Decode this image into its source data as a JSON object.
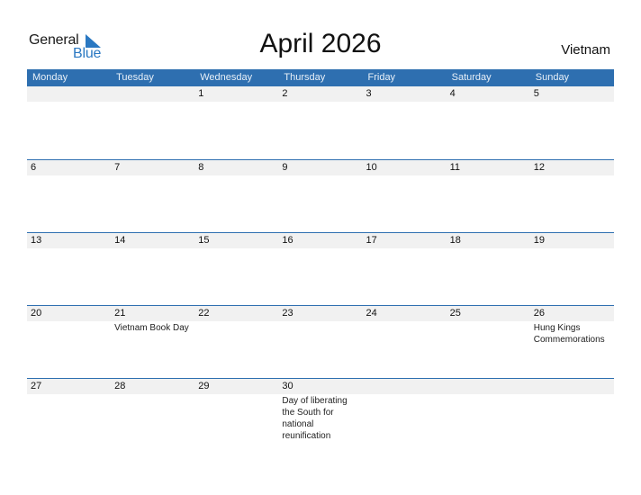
{
  "logo": {
    "line1": "General",
    "line2": "Blue"
  },
  "title": "April 2026",
  "country": "Vietnam",
  "weekdays": [
    "Monday",
    "Tuesday",
    "Wednesday",
    "Thursday",
    "Friday",
    "Saturday",
    "Sunday"
  ],
  "weeks": [
    {
      "days": [
        {
          "date": "",
          "event": ""
        },
        {
          "date": "",
          "event": ""
        },
        {
          "date": "1",
          "event": ""
        },
        {
          "date": "2",
          "event": ""
        },
        {
          "date": "3",
          "event": ""
        },
        {
          "date": "4",
          "event": ""
        },
        {
          "date": "5",
          "event": ""
        }
      ]
    },
    {
      "days": [
        {
          "date": "6",
          "event": ""
        },
        {
          "date": "7",
          "event": ""
        },
        {
          "date": "8",
          "event": ""
        },
        {
          "date": "9",
          "event": ""
        },
        {
          "date": "10",
          "event": ""
        },
        {
          "date": "11",
          "event": ""
        },
        {
          "date": "12",
          "event": ""
        }
      ]
    },
    {
      "days": [
        {
          "date": "13",
          "event": ""
        },
        {
          "date": "14",
          "event": ""
        },
        {
          "date": "15",
          "event": ""
        },
        {
          "date": "16",
          "event": ""
        },
        {
          "date": "17",
          "event": ""
        },
        {
          "date": "18",
          "event": ""
        },
        {
          "date": "19",
          "event": ""
        }
      ]
    },
    {
      "days": [
        {
          "date": "20",
          "event": ""
        },
        {
          "date": "21",
          "event": "Vietnam Book Day"
        },
        {
          "date": "22",
          "event": ""
        },
        {
          "date": "23",
          "event": ""
        },
        {
          "date": "24",
          "event": ""
        },
        {
          "date": "25",
          "event": ""
        },
        {
          "date": "26",
          "event": "Hung Kings Commemorations"
        }
      ]
    },
    {
      "days": [
        {
          "date": "27",
          "event": ""
        },
        {
          "date": "28",
          "event": ""
        },
        {
          "date": "29",
          "event": ""
        },
        {
          "date": "30",
          "event": "Day of liberating the South for national reunification"
        },
        {
          "date": "",
          "event": ""
        },
        {
          "date": "",
          "event": ""
        },
        {
          "date": "",
          "event": ""
        }
      ]
    }
  ],
  "colors": {
    "header_bg": "#2e6fb0",
    "brand_blue": "#2a78c2",
    "date_strip": "#f1f1f1"
  }
}
